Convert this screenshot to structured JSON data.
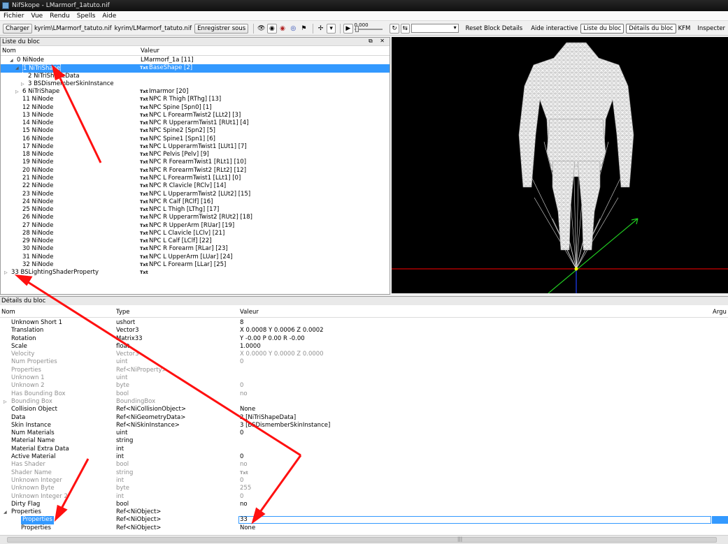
{
  "window": {
    "title": "NifSkope - LMarmorf_1atuto.nif"
  },
  "menu": [
    "Fichier",
    "Vue",
    "Rendu",
    "Spells",
    "Aide"
  ],
  "toolbar": {
    "load": "Charger",
    "path1": "kyrim\\LMarmorf_tatuto.nif",
    "path2": "kyrim/LMarmorf_tatuto.nif",
    "save_as": "Enregistrer sous",
    "time_value": "0.000",
    "reset_block": "Reset Block Details",
    "help": "Aide interactive",
    "block_list": "Liste du bloc",
    "block_details": "Détails du bloc",
    "kfm": "KFM",
    "inspect": "Inspecter"
  },
  "block_list": {
    "title": "Liste du bloc",
    "columns": {
      "name": "Nom",
      "value": "Valeur"
    },
    "rows": [
      {
        "name": "0 NiNode",
        "value": "LMarmorf_1a [11]",
        "txt": "",
        "indent": 1,
        "tri": "open"
      },
      {
        "name": "1 NiTriShape",
        "value": "BaseShape [2]",
        "txt": "Txt",
        "indent": 2,
        "tri": "open",
        "selected": true
      },
      {
        "name": "2 NiTriShapeData",
        "value": "",
        "txt": "",
        "indent": 3,
        "tri": ""
      },
      {
        "name": "3 BSDismemberSkinInstance",
        "value": "",
        "txt": "",
        "indent": 3,
        "tri": "closed"
      },
      {
        "name": "6 NiTriShape",
        "value": "Imarmor [20]",
        "txt": "Txt",
        "indent": 2,
        "tri": "closed"
      },
      {
        "name": "11 NiNode",
        "value": "NPC R Thigh [RThg] [13]",
        "txt": "Txt",
        "indent": 2,
        "tri": ""
      },
      {
        "name": "12 NiNode",
        "value": "NPC Spine [Spn0] [1]",
        "txt": "Txt",
        "indent": 2,
        "tri": ""
      },
      {
        "name": "13 NiNode",
        "value": "NPC L ForearmTwist2 [LLt2] [3]",
        "txt": "Txt",
        "indent": 2,
        "tri": ""
      },
      {
        "name": "14 NiNode",
        "value": "NPC R UpperarmTwist1 [RUt1] [4]",
        "txt": "Txt",
        "indent": 2,
        "tri": ""
      },
      {
        "name": "15 NiNode",
        "value": "NPC Spine2 [Spn2] [5]",
        "txt": "Txt",
        "indent": 2,
        "tri": ""
      },
      {
        "name": "16 NiNode",
        "value": "NPC Spine1 [Spn1] [6]",
        "txt": "Txt",
        "indent": 2,
        "tri": ""
      },
      {
        "name": "17 NiNode",
        "value": "NPC L UpperarmTwist1 [LUt1] [7]",
        "txt": "Txt",
        "indent": 2,
        "tri": ""
      },
      {
        "name": "18 NiNode",
        "value": "NPC Pelvis [Pelv] [9]",
        "txt": "Txt",
        "indent": 2,
        "tri": ""
      },
      {
        "name": "19 NiNode",
        "value": "NPC R ForearmTwist1 [RLt1] [10]",
        "txt": "Txt",
        "indent": 2,
        "tri": ""
      },
      {
        "name": "20 NiNode",
        "value": "NPC R ForearmTwist2 [RLt2] [12]",
        "txt": "Txt",
        "indent": 2,
        "tri": ""
      },
      {
        "name": "21 NiNode",
        "value": "NPC L ForearmTwist1 [LLt1] [0]",
        "txt": "Txt",
        "indent": 2,
        "tri": ""
      },
      {
        "name": "22 NiNode",
        "value": "NPC R Clavicle [RClv] [14]",
        "txt": "Txt",
        "indent": 2,
        "tri": ""
      },
      {
        "name": "23 NiNode",
        "value": "NPC L UpperarmTwist2 [LUt2] [15]",
        "txt": "Txt",
        "indent": 2,
        "tri": ""
      },
      {
        "name": "24 NiNode",
        "value": "NPC R Calf [RClf] [16]",
        "txt": "Txt",
        "indent": 2,
        "tri": ""
      },
      {
        "name": "25 NiNode",
        "value": "NPC L Thigh [LThg] [17]",
        "txt": "Txt",
        "indent": 2,
        "tri": ""
      },
      {
        "name": "26 NiNode",
        "value": "NPC R UpperarmTwist2 [RUt2] [18]",
        "txt": "Txt",
        "indent": 2,
        "tri": ""
      },
      {
        "name": "27 NiNode",
        "value": "NPC R UpperArm [RUar] [19]",
        "txt": "Txt",
        "indent": 2,
        "tri": ""
      },
      {
        "name": "28 NiNode",
        "value": "NPC L Clavicle [LClv] [21]",
        "txt": "Txt",
        "indent": 2,
        "tri": ""
      },
      {
        "name": "29 NiNode",
        "value": "NPC L Calf [LClf] [22]",
        "txt": "Txt",
        "indent": 2,
        "tri": ""
      },
      {
        "name": "30 NiNode",
        "value": "NPC R Forearm [RLar] [23]",
        "txt": "Txt",
        "indent": 2,
        "tri": ""
      },
      {
        "name": "31 NiNode",
        "value": "NPC L UpperArm [LUar] [24]",
        "txt": "Txt",
        "indent": 2,
        "tri": ""
      },
      {
        "name": "32 NiNode",
        "value": "NPC L Forearm [LLar] [25]",
        "txt": "Txt",
        "indent": 2,
        "tri": ""
      },
      {
        "name": "33 BSLightingShaderProperty",
        "value": "",
        "txt": "Txt",
        "indent": 0,
        "tri": "closed"
      }
    ]
  },
  "details": {
    "title": "Détails du bloc",
    "columns": {
      "name": "Nom",
      "type": "Type",
      "value": "Valeur",
      "arg": "Argu"
    },
    "rows": [
      {
        "name": "Unknown Short 1",
        "type": "ushort",
        "value": "8",
        "dim": false
      },
      {
        "name": "Translation",
        "type": "Vector3",
        "value": "X 0.0008 Y 0.0006 Z 0.0002",
        "dim": false
      },
      {
        "name": "Rotation",
        "type": "Matrix33",
        "value": "Y -0.00 P 0.00 R -0.00",
        "dim": false
      },
      {
        "name": "Scale",
        "type": "float",
        "value": "1.0000",
        "dim": false
      },
      {
        "name": "Velocity",
        "type": "Vector3",
        "value": "X 0.0000 Y 0.0000 Z 0.0000",
        "dim": true
      },
      {
        "name": "Num Properties",
        "type": "uint",
        "value": "0",
        "dim": true
      },
      {
        "name": "Properties",
        "type": "Ref<NiProperty>",
        "value": "",
        "dim": true
      },
      {
        "name": "Unknown 1",
        "type": "uint",
        "value": "",
        "dim": true
      },
      {
        "name": "Unknown 2",
        "type": "byte",
        "value": "0",
        "dim": true
      },
      {
        "name": "Has Bounding Box",
        "type": "bool",
        "value": "no",
        "dim": true
      },
      {
        "name": "Bounding Box",
        "type": "BoundingBox",
        "value": "",
        "dim": true,
        "tri": "closed"
      },
      {
        "name": "Collision Object",
        "type": "Ref<NiCollisionObject>",
        "value": "None",
        "dim": false
      },
      {
        "name": "Data",
        "type": "Ref<NiGeometryData>",
        "value": "2 [NiTriShapeData]",
        "dim": false
      },
      {
        "name": "Skin Instance",
        "type": "Ref<NiSkinInstance>",
        "value": "3 [BSDismemberSkinInstance]",
        "dim": false
      },
      {
        "name": "Num Materials",
        "type": "uint",
        "value": "0",
        "dim": false
      },
      {
        "name": "Material Name",
        "type": "string",
        "value": "",
        "dim": false
      },
      {
        "name": "Material Extra Data",
        "type": "int",
        "value": "",
        "dim": false
      },
      {
        "name": "Active Material",
        "type": "int",
        "value": "0",
        "dim": false
      },
      {
        "name": "Has Shader",
        "type": "bool",
        "value": "no",
        "dim": true
      },
      {
        "name": "Shader Name",
        "type": "string",
        "value": "Txt",
        "dim": true
      },
      {
        "name": "Unknown Integer",
        "type": "int",
        "value": "0",
        "dim": true
      },
      {
        "name": "Unknown Byte",
        "type": "byte",
        "value": "255",
        "dim": true
      },
      {
        "name": "Unknown Integer 2",
        "type": "int",
        "value": "0",
        "dim": true
      },
      {
        "name": "Dirty Flag",
        "type": "bool",
        "value": "no",
        "dim": false
      },
      {
        "name": "Properties",
        "type": "Ref<NiObject>",
        "value": "",
        "dim": false,
        "tri": "open"
      },
      {
        "name": "Properties",
        "type": "Ref<NiObject>",
        "value": "33",
        "dim": false,
        "selected": true,
        "indent": true
      },
      {
        "name": "Properties",
        "type": "Ref<NiObject>",
        "value": "None",
        "dim": false,
        "indent": true
      }
    ]
  },
  "colors": {
    "selection": "#3399ff",
    "annotation_arrow": "#ff1010",
    "axis_x": "#ff0000",
    "axis_y": "#22cc22",
    "axis_z": "#1f3fff",
    "viewport_bg": "#000000"
  }
}
